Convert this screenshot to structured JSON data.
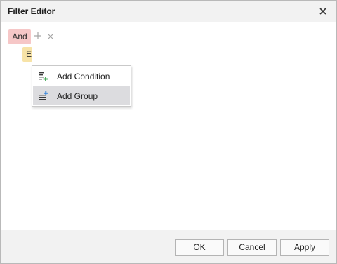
{
  "dialog": {
    "title": "Filter Editor",
    "close_icon": "close-icon"
  },
  "editor": {
    "group_operator": "And",
    "add_icon": "plus-icon",
    "remove_icon": "x-icon",
    "field_chip_text": "E"
  },
  "context_menu": {
    "items": [
      {
        "label": "Add Condition",
        "icon": "add-condition-icon"
      },
      {
        "label": "Add Group",
        "icon": "add-group-icon"
      }
    ],
    "highlight_color": "#dcdcdf"
  },
  "footer": {
    "ok_label": "OK",
    "cancel_label": "Cancel",
    "apply_label": "Apply"
  },
  "colors": {
    "operator_chip": "#f6c7c7",
    "field_chip": "#f7e3a7",
    "icon_green": "#2f9e44",
    "icon_blue": "#2b7fd9"
  }
}
